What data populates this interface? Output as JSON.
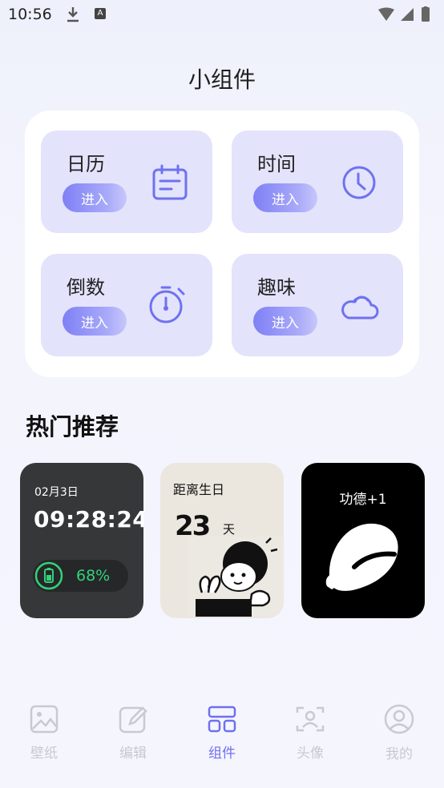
{
  "status": {
    "time": "10:56",
    "a_badge": "A"
  },
  "page": {
    "title": "小组件"
  },
  "categories": [
    {
      "label": "日历",
      "button": "进入",
      "icon": "calendar-icon"
    },
    {
      "label": "时间",
      "button": "进入",
      "icon": "clock-icon"
    },
    {
      "label": "倒数",
      "button": "进入",
      "icon": "stopwatch-icon"
    },
    {
      "label": "趣味",
      "button": "进入",
      "icon": "cloud-icon"
    }
  ],
  "recommend": {
    "title": "热门推荐",
    "clock_widget": {
      "date": "02月3日",
      "time": "09:28:24",
      "battery": "68%"
    },
    "birthday_widget": {
      "title": "距离生日",
      "days": "23",
      "unit": "天"
    },
    "merit_widget": {
      "title": "功德+1"
    }
  },
  "nav": {
    "items": [
      {
        "label": "壁纸",
        "icon": "image-icon"
      },
      {
        "label": "编辑",
        "icon": "edit-icon"
      },
      {
        "label": "组件",
        "icon": "widgets-icon",
        "active": true
      },
      {
        "label": "头像",
        "icon": "avatar-icon"
      },
      {
        "label": "我的",
        "icon": "profile-icon"
      }
    ]
  },
  "colors": {
    "accent": "#6f70ee",
    "card_bg": "#e3e3fc",
    "battery_green": "#33d27a"
  }
}
